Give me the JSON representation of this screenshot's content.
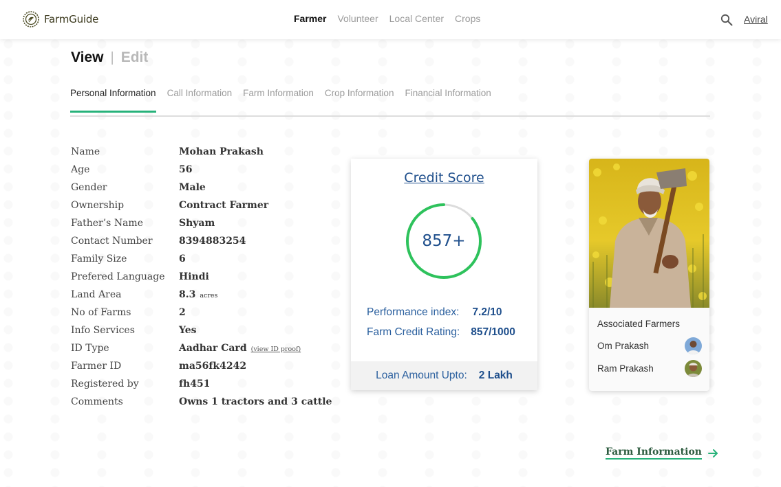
{
  "app": {
    "name": "FarmGuide",
    "user": "Aviral",
    "accent_color": "#27b27a",
    "brand_blue": "#1f4f8c"
  },
  "nav": {
    "items": [
      "Farmer",
      "Volunteer",
      "Local Center",
      "Crops"
    ],
    "active": "Farmer"
  },
  "mode": {
    "view": "View",
    "separator": "|",
    "edit": "Edit",
    "active": "View"
  },
  "tabs": {
    "items": [
      "Personal Information",
      "Call Information",
      "Farm Information",
      "Crop Information",
      "Financial Information"
    ],
    "active": "Personal Information"
  },
  "personal": {
    "rows": [
      {
        "label": "Name",
        "value": "Mohan Prakash"
      },
      {
        "label": "Age",
        "value": "56"
      },
      {
        "label": "Gender",
        "value": "Male"
      },
      {
        "label": "Ownership",
        "value": "Contract Farmer"
      },
      {
        "label": "Father’s Name",
        "value": "Shyam"
      },
      {
        "label": "Contact Number",
        "value": "8394883254"
      },
      {
        "label": "Family Size",
        "value": "6"
      },
      {
        "label": "Prefered Language",
        "value": "Hindi"
      },
      {
        "label": "Land Area",
        "value": "8.3",
        "unit": "acres"
      },
      {
        "label": "No of Farms",
        "value": "2"
      },
      {
        "label": "Info Services",
        "value": "Yes"
      },
      {
        "label": "ID Type",
        "value": "Aadhar Card",
        "link": "(view ID proof)"
      },
      {
        "label": "Farmer ID",
        "value": "ma56fk4242"
      },
      {
        "label": "Registered by",
        "value": "fh451"
      },
      {
        "label": "Comments",
        "value": "Owns 1 tractors and 3 cattle"
      }
    ]
  },
  "credit": {
    "title": "Credit Score",
    "score_display": "857+",
    "score_fraction": 0.857,
    "performance_label": "Performance index:",
    "performance_value": "7.2/10",
    "rating_label": "Farm Credit Rating:",
    "rating_value": "857/1000",
    "loan_label": "Loan Amount Upto:",
    "loan_value": "2 Lakh"
  },
  "associated": {
    "title": "Associated Farmers",
    "farmers": [
      {
        "name": "Om Prakash"
      },
      {
        "name": "Ram Prakash"
      }
    ]
  },
  "footer_nav": {
    "next_label": "Farm Information"
  }
}
